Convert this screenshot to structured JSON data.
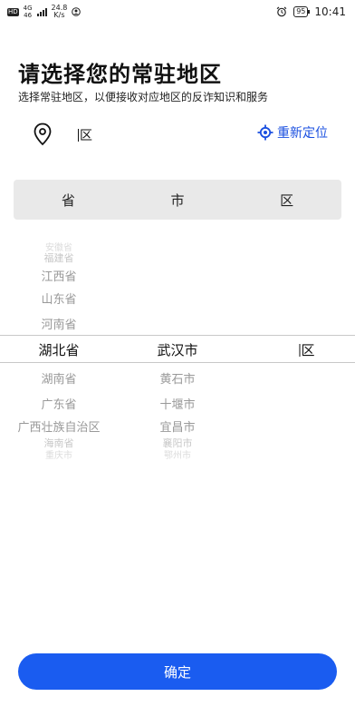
{
  "status_bar": {
    "hd": "HD",
    "net_type_top": "4G",
    "net_type_bottom": "46",
    "speed_value": "24.8",
    "speed_unit": "K/s",
    "battery": "95",
    "time": "10:41"
  },
  "header": {
    "title": "请选择您的常驻地区",
    "subtitle": "选择常驻地区，以便接收对应地区的反诈知识和服务"
  },
  "location": {
    "current_area": "区",
    "relocate_label": "重新定位",
    "accent_color": "#1a4fe0"
  },
  "picker": {
    "headers": [
      "省",
      "市",
      "区"
    ],
    "provinces_above": [
      "安徽省",
      "福建省",
      "江西省",
      "山东省",
      "河南省"
    ],
    "province_selected": "湖北省",
    "provinces_below": [
      "湖南省",
      "广东省",
      "广西壮族自治区",
      "海南省",
      "重庆市"
    ],
    "city_selected": "武汉市",
    "cities_below": [
      "黄石市",
      "十堰市",
      "宜昌市",
      "襄阳市",
      "鄂州市"
    ],
    "district_selected": "区"
  },
  "confirm": {
    "label": "确定",
    "color": "#1a5cf0"
  }
}
